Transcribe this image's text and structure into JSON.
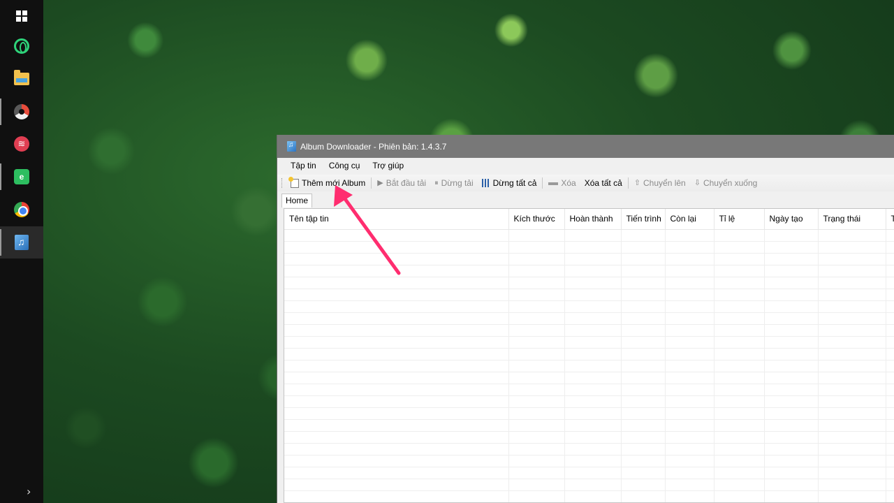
{
  "window": {
    "title": "Album Downloader - Phiên bản: 1.4.3.7"
  },
  "menu": [
    "Tập tin",
    "Công cụ",
    "Trợ giúp"
  ],
  "toolbar": {
    "add_album": "Thêm mới Album",
    "start_download": "Bắt đầu tải",
    "pause_download": "Dừng tải",
    "stop_all": "Dừng tất cả",
    "delete": "Xóa",
    "delete_all": "Xóa tất cả",
    "move_up": "Chuyển lên",
    "move_down": "Chuyển xuống"
  },
  "tabs": [
    "Home"
  ],
  "table": {
    "columns": [
      "Tên tập tin",
      "Kích thước",
      "Hoàn thành",
      "Tiến trình",
      "Còn lại",
      "Tỉ lệ",
      "Ngày tạo",
      "Trạng thái",
      "T"
    ],
    "rows": []
  },
  "taskbar": {
    "icons": [
      "windows-start-icon",
      "opera-icon",
      "file-explorer-icon",
      "davinci-resolve-icon",
      "red-app-icon",
      "evernote-icon",
      "chrome-icon",
      "album-downloader-icon",
      "chevron-right-icon"
    ]
  },
  "colors": {
    "annotation_arrow": "#ff2d6f",
    "titlebar": "#787878",
    "taskbar": "#101010"
  }
}
